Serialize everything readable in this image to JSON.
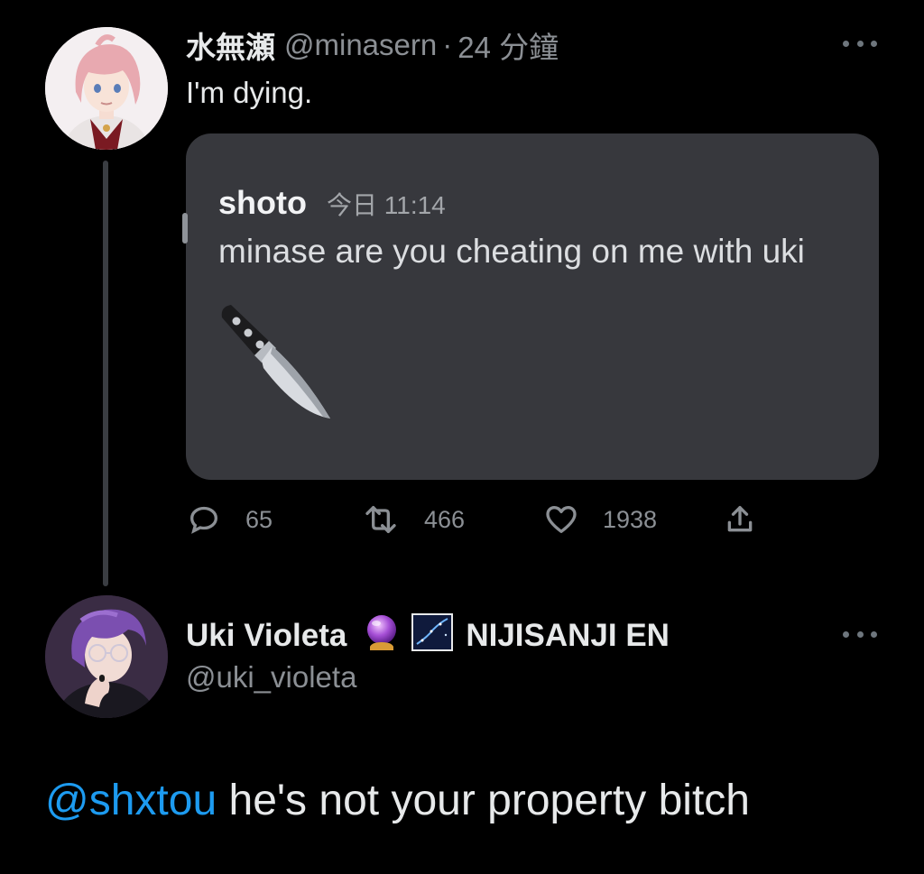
{
  "tweet": {
    "author": {
      "display_name": "水無瀬",
      "handle": "@minasern",
      "separator": "·",
      "time": "24 分鐘"
    },
    "text": "I'm dying.",
    "embed": {
      "username": "shoto",
      "timestamp": "今日 11:14",
      "message": "minase are you cheating on me with uki",
      "emoji": "knife-emoji"
    },
    "actions": {
      "replies": "65",
      "retweets": "466",
      "likes": "1938"
    }
  },
  "reply": {
    "author": {
      "display_name": "Uki Violeta",
      "affiliation": "NIJISANJI EN",
      "handle": "@uki_violeta"
    },
    "mention": "@shxtou",
    "text": " he's not your property bitch"
  },
  "colors": {
    "background": "#000000",
    "text": "#e7e9ea",
    "muted": "#8b8f94",
    "link": "#1d9bf0",
    "card": "#37383d"
  }
}
